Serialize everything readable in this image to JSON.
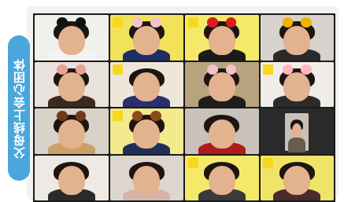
{
  "side_label": {
    "text": "父母线上会心团体",
    "color": "#4aa6db"
  },
  "participants": [
    {
      "id": "p1",
      "bg": "#f0f0ec",
      "filter": "#111111",
      "filter_name": "mouse-ears-filter",
      "body": "#f4f4f4",
      "badge": false
    },
    {
      "id": "p2",
      "bg": "#f2e25a",
      "filter": "#f4c2c8",
      "filter_name": "bunny-ears-filter",
      "body": "#1e2f66",
      "badge": true
    },
    {
      "id": "p3",
      "bg": "#f5e96a",
      "filter": "#d61f1f",
      "filter_name": "beret-filter",
      "body": "#1b1b1b",
      "badge": true
    },
    {
      "id": "p4",
      "bg": "#d8d2cc",
      "filter": "#f0b400",
      "filter_name": "crown-filter",
      "body": "#2a2a2a",
      "badge": false
    },
    {
      "id": "p5",
      "bg": "#e9e2dc",
      "filter": "#e8a28d",
      "filter_name": "pig-ears-filter",
      "body": "#3a2a20",
      "badge": false
    },
    {
      "id": "p6",
      "bg": "#eee6d8",
      "filter": "#ffffff",
      "filter_name": "none",
      "body": "#2a2f70",
      "badge": true
    },
    {
      "id": "p7",
      "bg": "#b9a27e",
      "filter": "#f1c3c3",
      "filter_name": "bunny-ears-filter",
      "body": "#1d1d1d",
      "badge": false
    },
    {
      "id": "p8",
      "bg": "#f0ede8",
      "filter": "#ffb6c1",
      "filter_name": "bunny-ears-filter",
      "body": "#2b2b2b",
      "badge": true
    },
    {
      "id": "p9",
      "bg": "#d9d2c9",
      "filter": "#6b3a1f",
      "filter_name": "bear-ears-filter",
      "body": "#c9a06a",
      "badge": false
    },
    {
      "id": "p10",
      "bg": "#f2ea8c",
      "filter": "#8a4b1d",
      "filter_name": "reindeer-antlers-filter",
      "body": "#1f2f5a",
      "badge": true
    },
    {
      "id": "p11",
      "bg": "#c9c2bb",
      "filter": "#1c1c1c",
      "filter_name": "none",
      "body": "#b01a1a",
      "badge": false
    },
    {
      "id": "p12",
      "bg": "#2a2a2a",
      "filter": "#2a2a2a",
      "filter_name": "none",
      "body": "#6b5b4f",
      "badge": false,
      "empty": true
    },
    {
      "id": "p13",
      "bg": "#efe9e3",
      "filter": "#2a1a1a",
      "filter_name": "none",
      "body": "#2a2a2a",
      "badge": false
    },
    {
      "id": "p14",
      "bg": "#ddd6cf",
      "filter": "#3a2a2a",
      "filter_name": "none",
      "body": "#d8b4a8",
      "badge": false
    },
    {
      "id": "p15",
      "bg": "#f5e96a",
      "filter": "#2a2a2a",
      "filter_name": "none",
      "body": "#3a3a3a",
      "badge": true
    },
    {
      "id": "p16",
      "bg": "#f0e468",
      "filter": "#2a2a2a",
      "filter_name": "none",
      "body": "#4a2a2a",
      "badge": true
    }
  ]
}
